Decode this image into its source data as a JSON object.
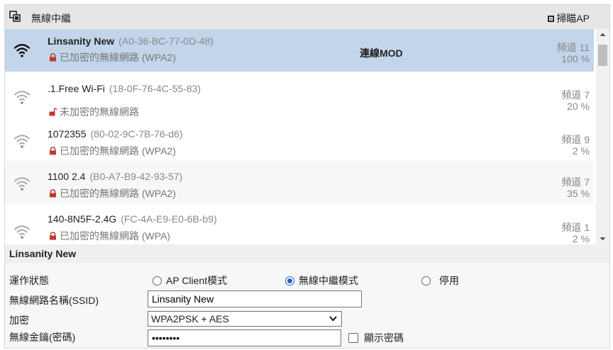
{
  "header": {
    "title": "無線中繼",
    "scan_label": "掃瞄AP"
  },
  "networks": [
    {
      "ssid": "Linsanity New",
      "mac": "(A0-36-BC-77-0D-48)",
      "security": "已加密的無線網路 (WPA2)",
      "locked": true,
      "channel": "頻道 11",
      "signal": "100 %",
      "status": "連線MOD",
      "selected": true
    },
    {
      "ssid": ".1.Free Wi-Fi",
      "mac": "(18-0F-76-4C-55-83)",
      "security": "未加密的無線網路",
      "locked": false,
      "channel": "頻道 7",
      "signal": "20 %"
    },
    {
      "ssid": "1072355",
      "mac": "(80-02-9C-7B-76-d6)",
      "security": "已加密的無線網路 (WPA2)",
      "locked": true,
      "channel": "頻道 9",
      "signal": "2 %"
    },
    {
      "ssid": "1100 2.4",
      "mac": "(B0-A7-B9-42-93-57)",
      "security": "已加密的無線網路 (WPA2)",
      "locked": true,
      "channel": "頻道 7",
      "signal": "35 %"
    },
    {
      "ssid": "140-8N5F-2.4G",
      "mac": "(FC-4A-E9-E0-6B-b9)",
      "security": "已加密的無線網路 (WPA)",
      "locked": true,
      "channel": "頻道 1",
      "signal": "2 %"
    }
  ],
  "detail": {
    "title": "Linsanity New",
    "mode_label": "運作狀態",
    "modes": [
      {
        "label": "AP Client模式",
        "checked": false
      },
      {
        "label": "無線中繼模式",
        "checked": true
      },
      {
        "label": "停用",
        "checked": false
      }
    ],
    "ssid_label": "無線網路名稱(SSID)",
    "ssid_value": "Linsanity New",
    "encryption_label": "加密",
    "encryption_value": "WPA2PSK + AES",
    "key_label": "無線金鑰(密碼)",
    "key_value": "••••••••",
    "show_password_label": "顯示密碼"
  },
  "colors": {
    "selected_row": "#c2d5eb",
    "wifi_selected": "#111111",
    "wifi_other": "#aaaaaa",
    "signal_dot": "#4caf50",
    "lock": "#c0392b"
  }
}
